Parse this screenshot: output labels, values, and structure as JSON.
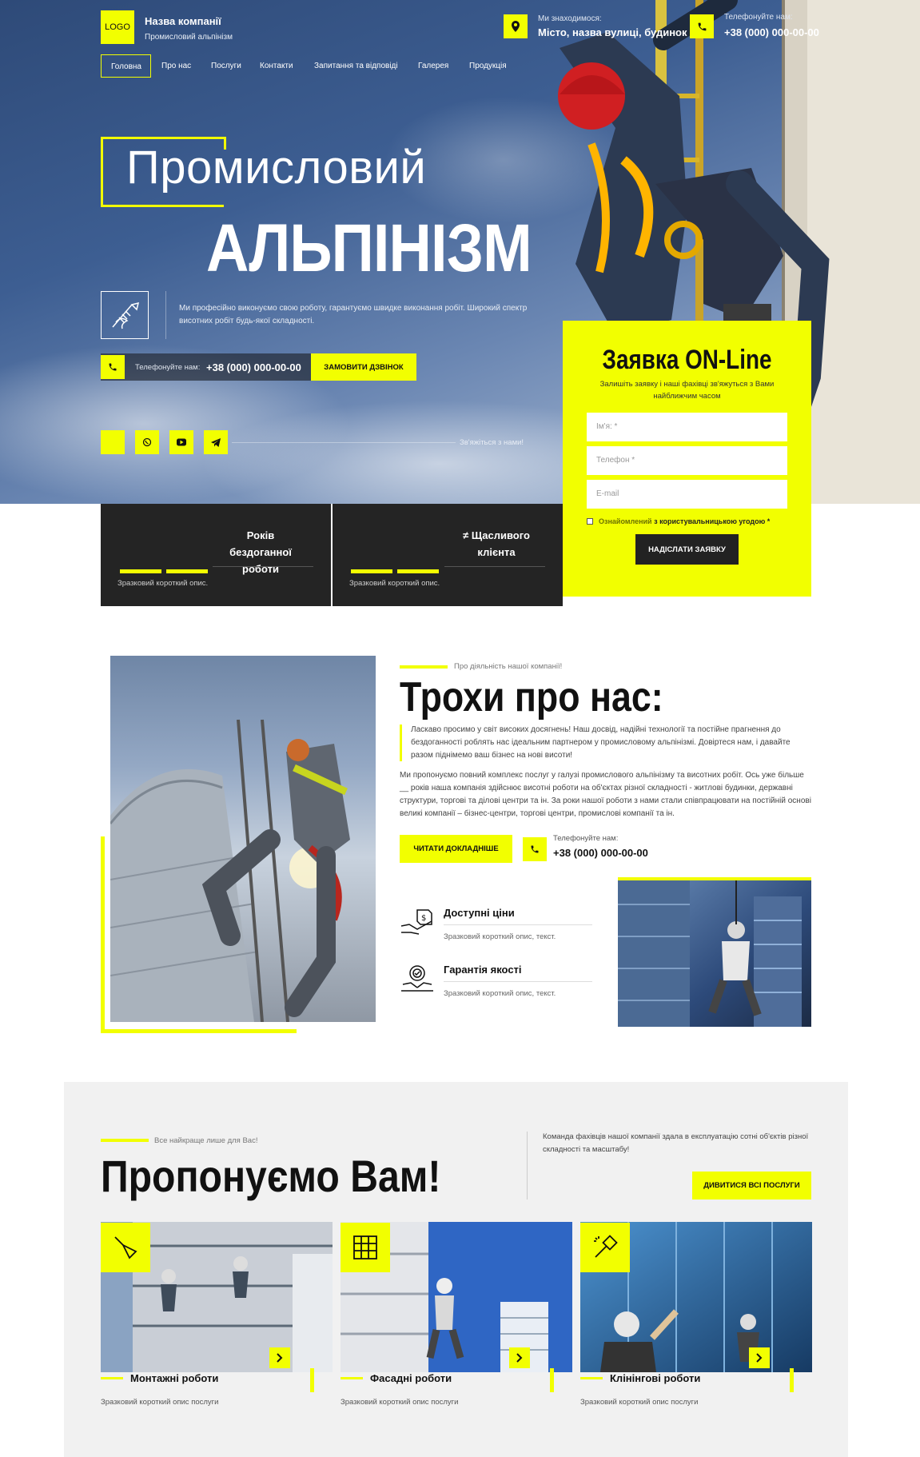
{
  "header": {
    "logo": "LOGO",
    "company_name": "Назва компанії",
    "company_sub": "Промисловий альпінізм",
    "location_label": "Ми знаходимося:",
    "location_value": "Місто, назва вулиці, будинок",
    "phone_label": "Телефонуйте нам:",
    "phone_value": "+38 (000) 000-00-00"
  },
  "nav": [
    "Головна",
    "Про нас",
    "Послуги",
    "Контакти",
    "Запитання та відповіді",
    "Галерея",
    "Продукція"
  ],
  "hero": {
    "title_line1": "Промисловий",
    "title_line2": "АЛЬПІНІЗМ",
    "lead": "Ми професійно виконуємо свою роботу, гарантуємо швидке виконання робіт. Широкий спектр висотних робіт будь-якої складності.",
    "call_label": "Телефонуйте нам:",
    "call_phone": "+38 (000) 000-00-00",
    "call_button": "ЗАМОВИТИ ДЗВІНОК",
    "contact_us": "Зв'яжіться з нами!"
  },
  "stats": [
    {
      "title": "Років бездоганної роботи",
      "desc": "Зразковий короткий опис."
    },
    {
      "title": "≠ Щасливого клієнта",
      "desc": "Зразковий короткий опис."
    }
  ],
  "form": {
    "title": "Заявка ON-Line",
    "subtitle": "Залишіть заявку і наші фахівці зв'яжуться з Вами найближчим часом",
    "name_placeholder": "Ім'я: *",
    "phone_placeholder": "Телефон *",
    "email_placeholder": "E-mail",
    "agree_link": "Ознайомлений",
    "agree_text": " з користувальницькою угодою *",
    "submit": "НАДІСЛАТИ ЗАЯВКУ"
  },
  "about": {
    "eyebrow": "Про діяльність нашої компанії!",
    "title": "Трохи про нас:",
    "quote": "Ласкаво просимо у світ високих досягнень! Наш досвід, надійні технології та постійне прагнення до бездоганності роблять нас ідеальним партнером у промисловому альпінізмі. Довіртеся нам, і давайте разом піднімемо ваш бізнес на нові висоти!",
    "text": "Ми пропонуємо повний комплекс послуг у галузі промислового альпінізму та висотних робіт. Ось уже більше __ років наша компанія здійснює висотні роботи на об'єктах різної складності - житлові будинки, державні структури, торгові та ділові центри та ін. За роки нашої роботи з нами стали співпрацювати на постійній основі великі компанії – бізнес-центри, торгові центри, промислові компанії та ін.",
    "more_button": "ЧИТАТИ ДОКЛАДНІШЕ",
    "phone_label": "Телефонуйте нам:",
    "phone_value": "+38 (000) 000-00-00",
    "features": [
      {
        "title": "Доступні ціни",
        "text": "Зразковий короткий опис, текст.",
        "icon": "price-tag-icon"
      },
      {
        "title": "Гарантія якості",
        "text": "Зразковий короткий опис, текст.",
        "icon": "quality-badge-icon"
      }
    ]
  },
  "offers": {
    "eyebrow": "Все найкраще лише для Вас!",
    "title": "Пропонуємо Вам!",
    "side_text": "Команда фахівців нашої компанії здала в експлуатацію сотні об'єктів різної складності та масштабу!",
    "all_button": "ДИВИТИСЯ ВСІ ПОСЛУГИ",
    "cards": [
      {
        "title": "Монтажні роботи",
        "desc": "Зразковий короткий опис послуги",
        "icon": "trowel-icon"
      },
      {
        "title": "Фасадні роботи",
        "desc": "Зразковий короткий опис послуги",
        "icon": "scaffold-icon"
      },
      {
        "title": "Клінінгові роботи",
        "desc": "Зразковий короткий опис послуги",
        "icon": "cleaning-icon"
      }
    ]
  },
  "colors": {
    "accent": "#f2ff00",
    "dark": "#242424"
  }
}
